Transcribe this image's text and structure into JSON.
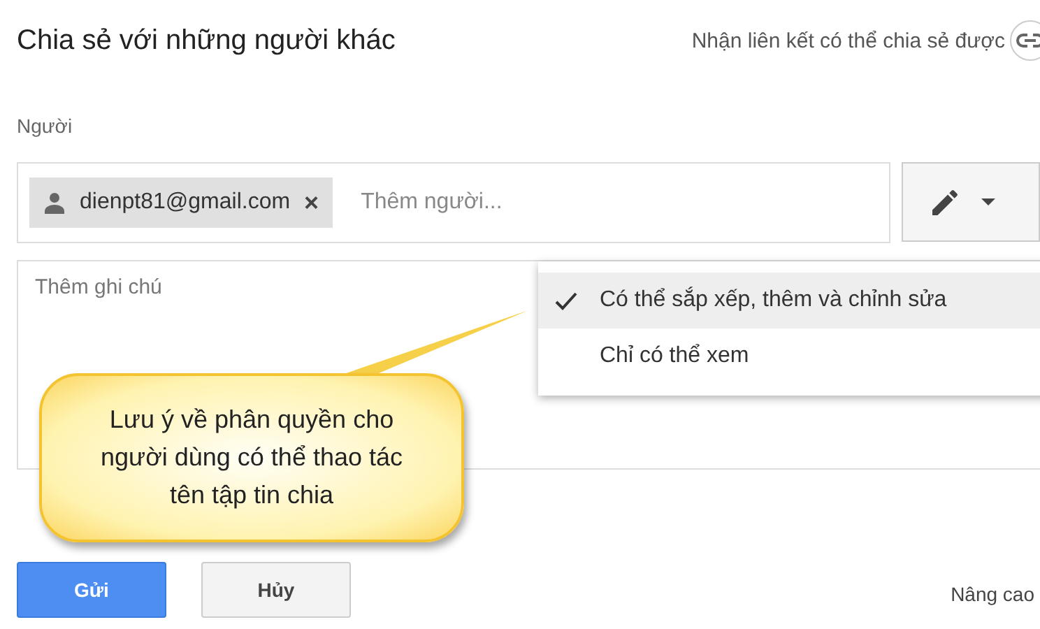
{
  "title": "Chia sẻ với những người khác",
  "share_link": {
    "label": "Nhận liên kết có thể chia sẻ được"
  },
  "people": {
    "label": "Người",
    "recipients": [
      {
        "email": "dienpt81@gmail.com",
        "remove": "×"
      }
    ],
    "placeholder": "Thêm người..."
  },
  "note": {
    "placeholder": "Thêm ghi chú"
  },
  "permission_menu": [
    {
      "label": "Có thể sắp xếp, thêm và chỉnh sửa",
      "selected": true
    },
    {
      "label": "Chỉ có thể xem",
      "selected": false
    }
  ],
  "callout": {
    "text": "Lưu ý về phân quyền cho người dùng có thể thao tác tên tập tin chia"
  },
  "buttons": [
    {
      "label": "Gửi",
      "kind": "primary"
    },
    {
      "label": "Hủy",
      "kind": "secondary"
    }
  ],
  "advanced": "Nâng cao"
}
